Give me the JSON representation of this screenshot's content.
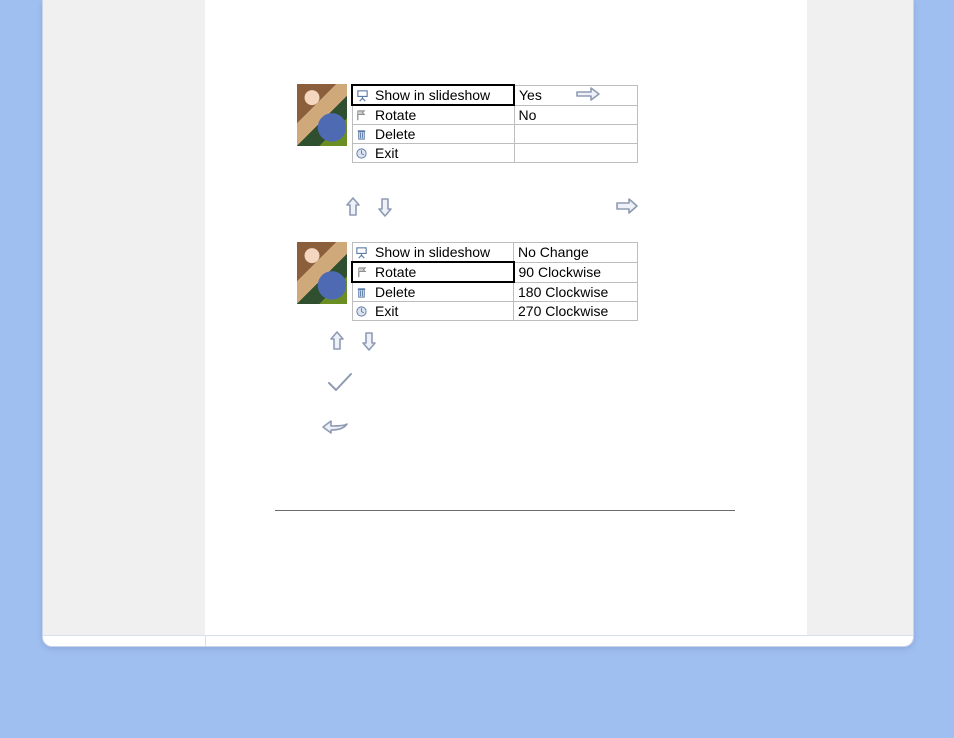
{
  "menu1": {
    "rows": [
      {
        "label": "Show in slideshow",
        "value": "Yes",
        "icon": "presentation-icon",
        "selected": true
      },
      {
        "label": "Rotate",
        "value": "No",
        "icon": "flag-icon",
        "selected": false
      },
      {
        "label": "Delete",
        "value": "",
        "icon": "trash-icon",
        "selected": false
      },
      {
        "label": "Exit",
        "value": "",
        "icon": "clock-icon",
        "selected": false
      }
    ]
  },
  "menu2": {
    "rows": [
      {
        "label": "Show in slideshow",
        "value": "No Change",
        "icon": "presentation-icon",
        "selected": false
      },
      {
        "label": "Rotate",
        "value": "90 Clockwise",
        "icon": "flag-icon",
        "selected": true
      },
      {
        "label": "Delete",
        "value": "180 Clockwise",
        "icon": "trash-icon",
        "selected": false
      },
      {
        "label": "Exit",
        "value": "270 Clockwise",
        "icon": "clock-icon",
        "selected": false
      }
    ]
  },
  "icons": {
    "up": "arrow-up-icon",
    "down": "arrow-down-icon",
    "right": "arrow-right-icon",
    "confirm": "check-icon",
    "back": "back-arrow-icon",
    "link": "link-arrow-icon"
  }
}
